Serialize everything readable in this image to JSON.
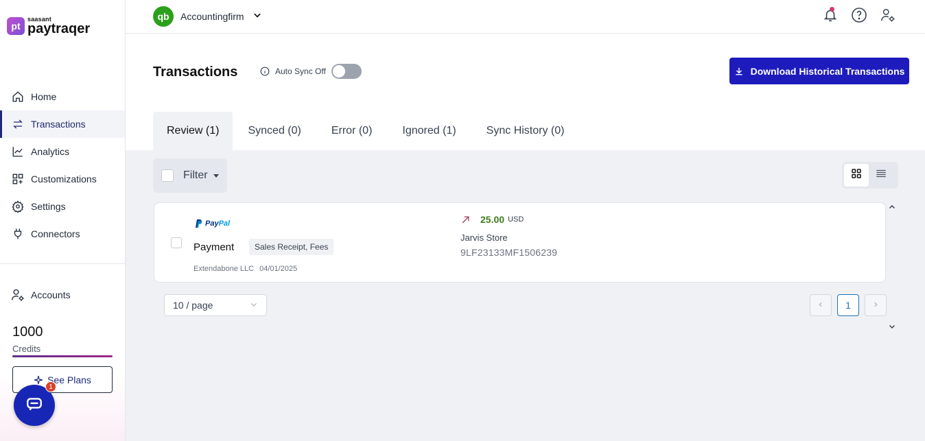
{
  "brand": {
    "logo_mark": "pt",
    "logo_sub": "saasant",
    "logo_main": "paytraqer"
  },
  "sidebar": {
    "items": [
      {
        "label": "Home",
        "icon": "home-icon"
      },
      {
        "label": "Transactions",
        "icon": "swap-arrows-icon",
        "active": true
      },
      {
        "label": "Analytics",
        "icon": "line-chart-icon"
      },
      {
        "label": "Customizations",
        "icon": "grid-plus-icon"
      },
      {
        "label": "Settings",
        "icon": "gear-icon"
      },
      {
        "label": "Connectors",
        "icon": "plug-icon"
      }
    ],
    "accounts_label": "Accounts",
    "credits_value": "1000",
    "credits_label": "Credits",
    "credits_fraction": 1.0,
    "see_plans_label": "See Plans",
    "chat_badge_count": "1"
  },
  "topbar": {
    "company_logo": "qb",
    "company_name": "Accountingfirm",
    "icons": [
      "bell-icon",
      "help-circle-icon",
      "user-settings-icon"
    ]
  },
  "page": {
    "title": "Transactions",
    "auto_sync_label": "Auto Sync Off",
    "auto_sync_on": false,
    "download_label": "Download Historical Transactions"
  },
  "tabs": [
    {
      "label": "Review (1)",
      "active": true
    },
    {
      "label": "Synced (0)"
    },
    {
      "label": "Error (0)"
    },
    {
      "label": "Ignored (1)"
    },
    {
      "label": "Sync History (0)"
    }
  ],
  "filter_label": "Filter",
  "transactions": [
    {
      "source_part1": "Pay",
      "source_part2": "Pal",
      "type": "Payment",
      "tag": "Sales Receipt, Fees",
      "company": "Extendabone LLC",
      "date": "04/01/2025",
      "amount": "25.00",
      "currency": "USD",
      "store": "Jarvis Store",
      "reference": "9LF23133MF1506239"
    }
  ],
  "pagination": {
    "page_size": "10 / page",
    "current_page": "1"
  },
  "colors": {
    "accent": "#1e1bbd",
    "amount_green": "#3f7d20",
    "qb_green": "#2ca01c"
  }
}
